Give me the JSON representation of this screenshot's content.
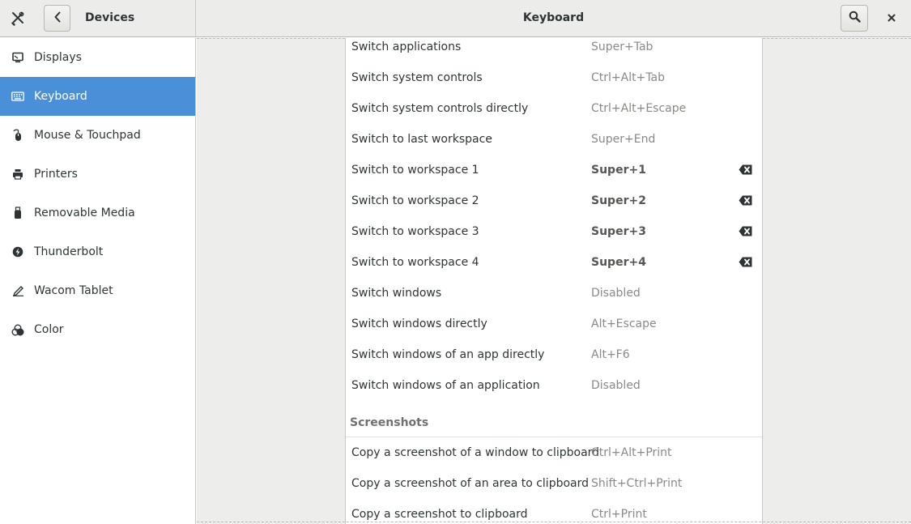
{
  "header": {
    "section_title": "Devices",
    "page_title": "Keyboard"
  },
  "sidebar": {
    "items": [
      {
        "label": "Displays",
        "icon": "display-icon"
      },
      {
        "label": "Keyboard",
        "icon": "keyboard-icon",
        "active": true
      },
      {
        "label": "Mouse & Touchpad",
        "icon": "mouse-icon"
      },
      {
        "label": "Printers",
        "icon": "printer-icon"
      },
      {
        "label": "Removable Media",
        "icon": "usb-drive-icon"
      },
      {
        "label": "Thunderbolt",
        "icon": "thunderbolt-icon"
      },
      {
        "label": "Wacom Tablet",
        "icon": "pen-tablet-icon"
      },
      {
        "label": "Color",
        "icon": "color-icon"
      }
    ]
  },
  "shortcuts": {
    "rows": [
      {
        "name": "Switch applications",
        "accel": "Super+Tab"
      },
      {
        "name": "Switch system controls",
        "accel": "Ctrl+Alt+Tab"
      },
      {
        "name": "Switch system controls directly",
        "accel": "Ctrl+Alt+Escape"
      },
      {
        "name": "Switch to last workspace",
        "accel": "Super+End"
      },
      {
        "name": "Switch to workspace 1",
        "accel": "Super+1"
      },
      {
        "name": "Switch to workspace 2",
        "accel": "Super+2"
      },
      {
        "name": "Switch to workspace 3",
        "accel": "Super+3"
      },
      {
        "name": "Switch to workspace 4",
        "accel": "Super+4"
      },
      {
        "name": "Switch windows",
        "accel": "Disabled"
      },
      {
        "name": "Switch windows directly",
        "accel": "Alt+Escape"
      },
      {
        "name": "Switch windows of an app directly",
        "accel": "Alt+F6"
      },
      {
        "name": "Switch windows of an application",
        "accel": "Disabled"
      }
    ],
    "screenshots_section": "Screenshots",
    "screenshot_rows": [
      {
        "name": "Copy a screenshot of a window to clipboard",
        "accel": "Ctrl+Alt+Print"
      },
      {
        "name": "Copy a screenshot of an area to clipboard",
        "accel": "Shift+Ctrl+Print"
      },
      {
        "name": "Copy a screenshot to clipboard",
        "accel": "Ctrl+Print"
      }
    ]
  },
  "colors": {
    "accent": "#4a90d9",
    "headerbar": "#ececea",
    "content_bg": "#ededeb"
  }
}
